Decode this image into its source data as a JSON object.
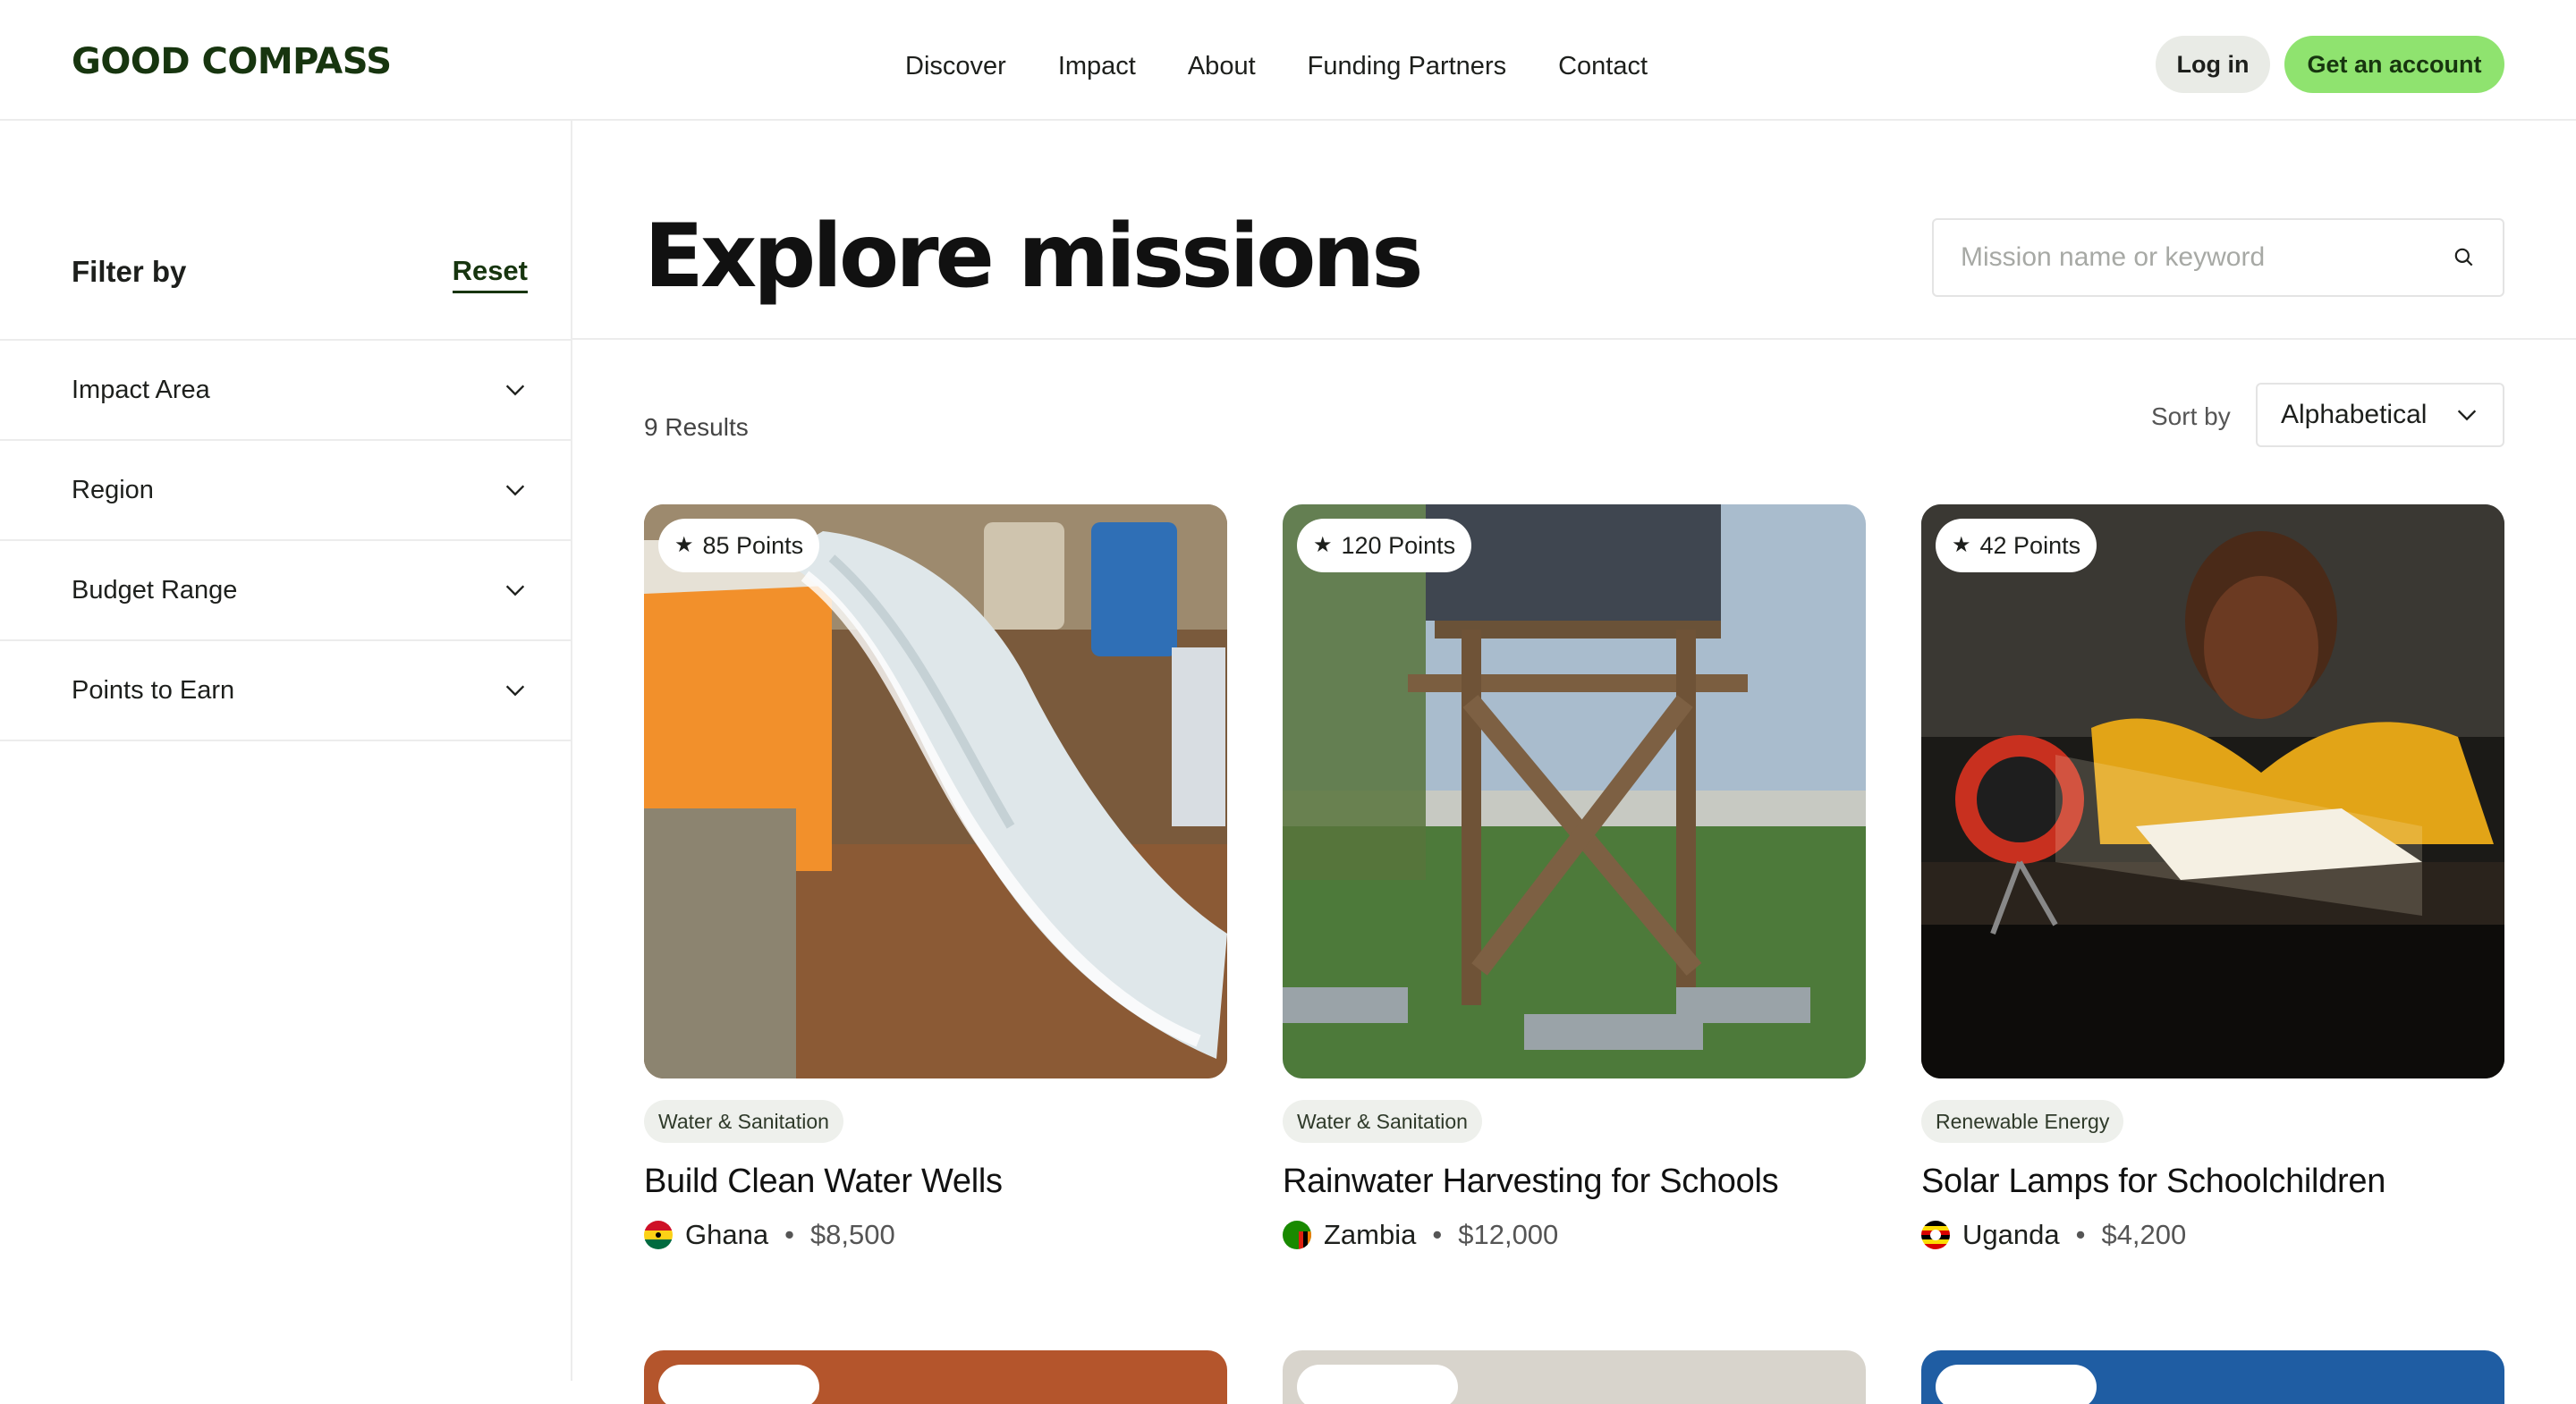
{
  "brand": {
    "logo": "GOOD COMPASS"
  },
  "nav": {
    "items": [
      "Discover",
      "Impact",
      "About",
      "Funding Partners",
      "Contact"
    ]
  },
  "auth": {
    "login": "Log in",
    "signup": "Get an account"
  },
  "colors": {
    "brand_green": "#17350f",
    "accent_green": "#8fe36f",
    "pill_gray": "#e9ebe6"
  },
  "sidebar": {
    "title": "Filter by",
    "reset": "Reset",
    "filters": [
      "Impact Area",
      "Region",
      "Budget Range",
      "Points to Earn"
    ]
  },
  "main": {
    "title": "Explore missions",
    "search_placeholder": "Mission name or keyword",
    "results": "9 Results",
    "sort_label": "Sort by",
    "sort_value": "Alphabetical"
  },
  "cards": [
    {
      "points": "85 Points",
      "tag": "Water & Sanitation",
      "title": "Build Clean Water Wells",
      "country": "Ghana",
      "amount": "$8,500",
      "flag": "ghana-flag-icon"
    },
    {
      "points": "120 Points",
      "tag": "Water & Sanitation",
      "title": "Rainwater Harvesting for Schools",
      "country": "Zambia",
      "amount": "$12,000",
      "flag": "zambia-flag-icon"
    },
    {
      "points": "42 Points",
      "tag": "Renewable Energy",
      "title": "Solar Lamps for Schoolchildren",
      "country": "Uganda",
      "amount": "$4,200",
      "flag": "uganda-flag-icon"
    }
  ]
}
